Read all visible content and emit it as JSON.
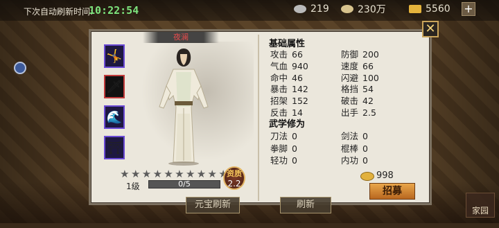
{
  "topbar": {
    "refresh_label": "下次自动刷新时间:",
    "refresh_time": "10:22:54",
    "resources": [
      {
        "icon": "silver-icon",
        "value": "219",
        "color": "#b9b9b9"
      },
      {
        "icon": "coins-icon",
        "value": "230万",
        "color": "#d8c38d"
      },
      {
        "icon": "gold-ingot-icon",
        "value": "5560",
        "color": "#e5b33c"
      }
    ],
    "plus_label": "+"
  },
  "dialog": {
    "close_label": "✕",
    "character_name": "夜澜",
    "level": "1级",
    "exp": {
      "text": "0/5",
      "fraction": 0.0
    },
    "stars": {
      "total": 10,
      "filled": 0
    },
    "aptitude": {
      "label": "资质",
      "value": "2.2"
    },
    "skills": [
      {
        "icon": "dancer-skill-icon",
        "frame": "purple",
        "glyph": "🤸"
      },
      {
        "icon": "swordsman-skill-icon",
        "frame": "red",
        "glyph": "🗡"
      },
      {
        "icon": "wave-skill-icon",
        "frame": "purple",
        "glyph": "🌊"
      },
      {
        "icon": "palace-skill-icon",
        "frame": "purple",
        "glyph": "⛩"
      }
    ],
    "basic_title": "基础属性",
    "basic_stats": [
      {
        "label": "攻击",
        "value": "66"
      },
      {
        "label": "防御",
        "value": "200"
      },
      {
        "label": "气血",
        "value": "940"
      },
      {
        "label": "速度",
        "value": "66"
      },
      {
        "label": "命中",
        "value": "46"
      },
      {
        "label": "闪避",
        "value": "100"
      },
      {
        "label": "暴击",
        "value": "142"
      },
      {
        "label": "格挡",
        "value": "54"
      },
      {
        "label": "招架",
        "value": "152"
      },
      {
        "label": "破击",
        "value": "42"
      },
      {
        "label": "反击",
        "value": "14"
      },
      {
        "label": "出手",
        "value": "2.5"
      }
    ],
    "martial_title": "武学修为",
    "martial_stats": [
      {
        "label": "刀法",
        "value": "0"
      },
      {
        "label": "剑法",
        "value": "0"
      },
      {
        "label": "拳脚",
        "value": "0"
      },
      {
        "label": "棍棒",
        "value": "0"
      },
      {
        "label": "轻功",
        "value": "0"
      },
      {
        "label": "内功",
        "value": "0"
      }
    ],
    "cost": "998",
    "recruit_label": "招募"
  },
  "bottom": {
    "ingot_refresh_label": "元宝刷新",
    "refresh_label": "刷新",
    "family_label": "家园"
  }
}
